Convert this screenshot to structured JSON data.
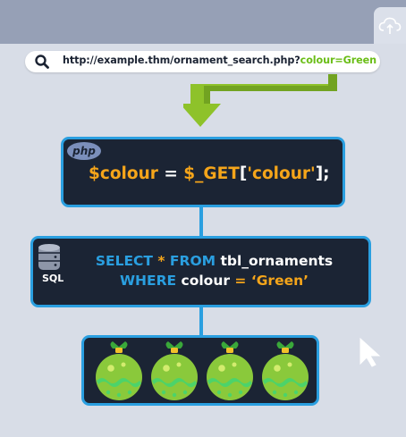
{
  "browser": {
    "url_base": "http://example.thm/ornament_search.php?",
    "url_param": "colour=Green"
  },
  "php": {
    "badge": "php",
    "code": {
      "var": "$colour",
      "eq": " = ",
      "get": "$_GET",
      "bracket_open": "[",
      "key": "'colour'",
      "bracket_close": "];"
    }
  },
  "sql": {
    "label": "SQL",
    "line1": {
      "kw1": "SELECT",
      "op": " * ",
      "kw2": "FROM",
      "table": " tbl_ornaments"
    },
    "line2": {
      "kw": "WHERE",
      "col": " colour ",
      "op": "=",
      "value": " ‘Green’"
    }
  },
  "ornaments": {
    "count": 4,
    "color": "#8ac93b",
    "accent": "#4cd36a",
    "cap": "#f2c02a",
    "bow": "#3aa83a"
  },
  "colors": {
    "accent_blue": "#2a9fe0",
    "accent_orange": "#f5a51a",
    "box_bg": "#1b2434",
    "arrow_green": "#8ec22a"
  },
  "icons": [
    "search-icon",
    "cloud-upload-icon",
    "database-icon",
    "arrow-down-icon",
    "cursor-icon"
  ]
}
